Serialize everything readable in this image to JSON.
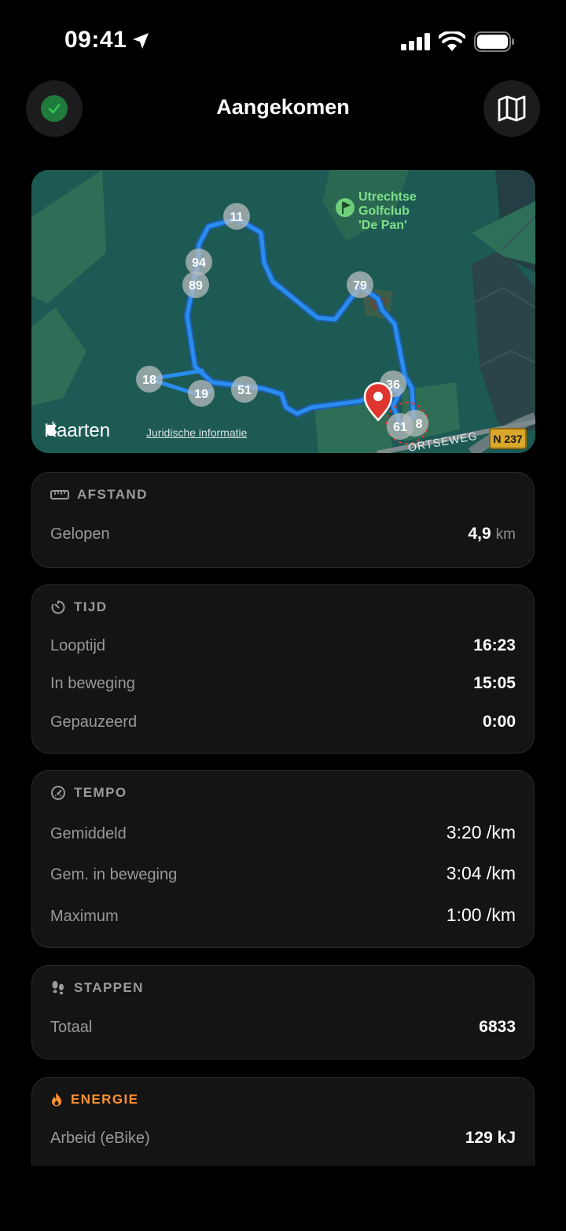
{
  "status": {
    "time": "09:41"
  },
  "nav": {
    "title": "Aangekomen",
    "left_icon": "checkmark-icon",
    "right_icon": "map-icon"
  },
  "map": {
    "poi": "Utrechtse Golfclub 'De Pan'",
    "poi_line1": "Utrechtse",
    "poi_line2": "Golfclub",
    "poi_line3": "'De Pan'",
    "markers": [
      "11",
      "94",
      "89",
      "79",
      "18",
      "19",
      "51",
      "36",
      "61",
      "8"
    ],
    "street": "ORTSEWEG",
    "road_number": "N 237",
    "brand": "Kaarten",
    "legal_link": "Juridische informatie",
    "route_color": "#2a8cf0"
  },
  "afstand": {
    "title": "AFSTAND",
    "rows": [
      {
        "label": "Gelopen",
        "value": "4,9",
        "unit": "km"
      }
    ]
  },
  "tijd": {
    "title": "TIJD",
    "rows": [
      {
        "label": "Looptijd",
        "value": "16:23"
      },
      {
        "label": "In beweging",
        "value": "15:05"
      },
      {
        "label": "Gepauzeerd",
        "value": "0:00"
      }
    ]
  },
  "tempo": {
    "title": "TEMPO",
    "rows": [
      {
        "label": "Gemiddeld",
        "value": "3:20 /km"
      },
      {
        "label": "Gem. in beweging",
        "value": "3:04 /km"
      },
      {
        "label": "Maximum",
        "value": "1:00 /km"
      }
    ]
  },
  "stappen": {
    "title": "STAPPEN",
    "rows": [
      {
        "label": "Totaal",
        "value": "6833"
      }
    ]
  },
  "energie": {
    "title": "ENERGIE",
    "accent": "#ff9230",
    "rows": [
      {
        "label": "Arbeid (eBike)",
        "value": "129 kJ"
      }
    ]
  }
}
